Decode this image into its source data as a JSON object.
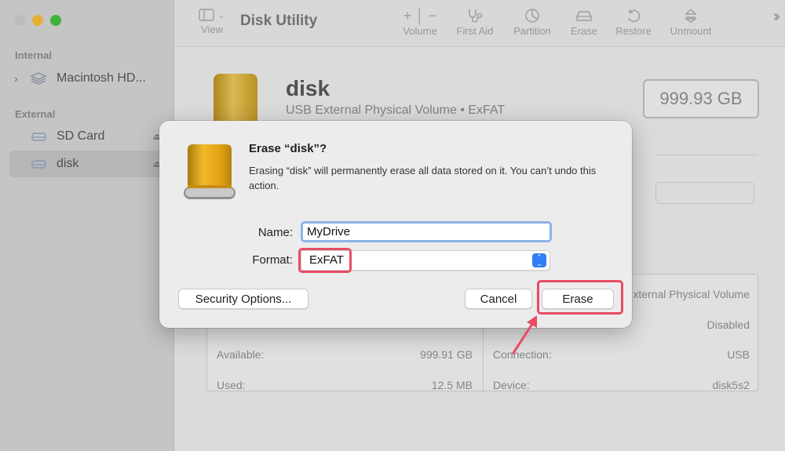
{
  "app_title": "Disk Utility",
  "toolbar": {
    "view_label": "View",
    "volume_label": "Volume",
    "first_aid_label": "First Aid",
    "partition_label": "Partition",
    "erase_label": "Erase",
    "restore_label": "Restore",
    "unmount_label": "Unmount"
  },
  "sidebar": {
    "internal_label": "Internal",
    "external_label": "External",
    "items": [
      {
        "label": "Macintosh HD..."
      },
      {
        "label": "SD Card"
      },
      {
        "label": "disk"
      }
    ]
  },
  "disk": {
    "name": "disk",
    "subtitle": "USB External Physical Volume • ExFAT",
    "size": "999.93 GB"
  },
  "info": {
    "available_label": "Available:",
    "available_value": "999.91 GB",
    "used_label": "Used:",
    "used_value": "12.5 MB",
    "type_value": "xternal Physical Volume",
    "owners_value": "Disabled",
    "connection_label": "Connection:",
    "connection_value": "USB",
    "device_label": "Device:",
    "device_value": "disk5s2"
  },
  "dialog": {
    "title": "Erase “disk”?",
    "message": "Erasing “disk” will permanently erase all data stored on it. You can’t undo this action.",
    "name_label": "Name:",
    "name_value": "MyDrive",
    "format_label": "Format:",
    "format_value": "ExFAT",
    "security_button": "Security Options...",
    "cancel_button": "Cancel",
    "erase_button": "Erase"
  },
  "colors": {
    "highlight": "#e74c64",
    "accent": "#2f7ff4",
    "drive_gold": "#e2a21a"
  }
}
